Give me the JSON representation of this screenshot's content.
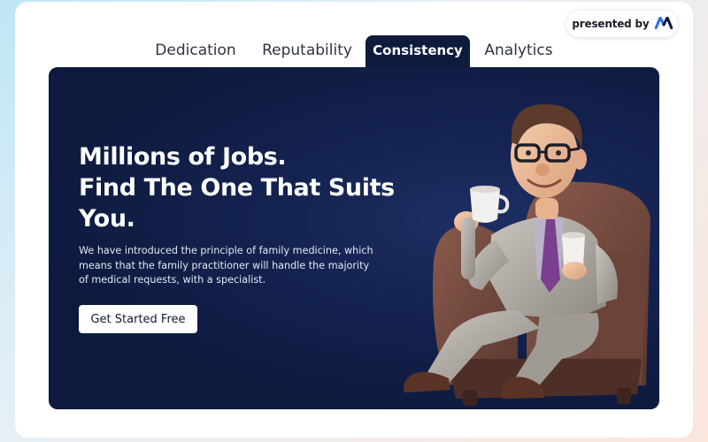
{
  "presented_by": {
    "label": "presented by",
    "logo_icon": "brand-logo-icon"
  },
  "tabs": [
    {
      "label": "Dedication",
      "active": false
    },
    {
      "label": "Reputability",
      "active": false
    },
    {
      "label": "Consistency",
      "active": true
    },
    {
      "label": "Analytics",
      "active": false
    }
  ],
  "hero": {
    "headline_lines": [
      "Millions of Jobs.",
      "Find The One That Suits",
      "You."
    ],
    "description": "We have introduced the principle of family medicine, which means that the family practitioner will handle the majority of medical requests, with a specialist.",
    "cta_label": "Get Started Free",
    "illustration": "man-in-armchair-with-coffee-illustration"
  },
  "colors": {
    "hero_background": "#0f1b3d",
    "active_tab": "#0f1b3d",
    "cta_background": "#ffffff",
    "logo_primary": "#2d6ff2"
  }
}
